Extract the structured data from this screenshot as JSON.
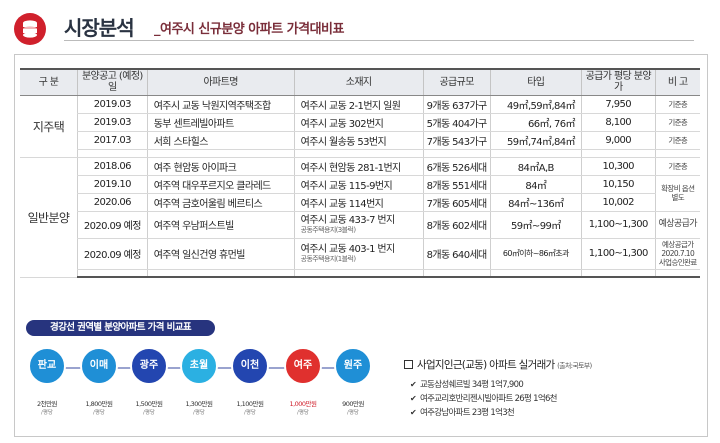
{
  "header": {
    "title": "시장분석",
    "subtitle": "_여주시 신규분양 아파트 가격대비표"
  },
  "table": {
    "headers": [
      "구 분",
      "분양공고 (예정)일",
      "아파트명",
      "소재지",
      "공급규모",
      "타입",
      "공급가 평당 분양가",
      "비 고"
    ],
    "groups": [
      {
        "label": "지주택",
        "rows": [
          {
            "date": "2019.03",
            "name": "여주시 교동 낙원지역주택조합",
            "addr": "여주시 교동 2-1번지 일원",
            "addr_sub": "",
            "scale": "9개동 637가구",
            "type": "49㎡,59㎡,84㎡",
            "price": "7,950",
            "note": "기준층"
          },
          {
            "date": "2019.03",
            "name": "동부 센트레빌아파트",
            "addr": "여주시 교동 302번지",
            "addr_sub": "",
            "scale": "5개동 404가구",
            "type": "66㎡, 76㎡",
            "price": "8,100",
            "note": "기준층"
          },
          {
            "date": "2017.03",
            "name": "서희 스타힐스",
            "addr": "여주시 월송동 53번지",
            "addr_sub": "",
            "scale": "7개동 543가구",
            "type": "59㎡,74㎡,84㎡",
            "price": "9,000",
            "note": "기준층"
          }
        ]
      },
      {
        "label": "일반분양",
        "rows": [
          {
            "date": "2018.06",
            "name": "여주 현암동 아이파크",
            "addr": "여주시 현암동 281-1번지",
            "addr_sub": "",
            "scale": "6개동 526세대",
            "type": "84㎡A,B",
            "price": "10,300",
            "note": "기준층"
          },
          {
            "date": "2019.10",
            "name": "여주역 대우푸르지오 클라레드",
            "addr": "여주시 교동 115-9번지",
            "addr_sub": "",
            "scale": "8개동 551세대",
            "type": "84㎡",
            "price": "10,150",
            "note": "확장비 옵션별도"
          },
          {
            "date": "2020.06",
            "name": "여주역 금호어울림 베르티스",
            "addr": "여주시 교동 114번지",
            "addr_sub": "",
            "scale": "7개동 605세대",
            "type": "84㎡~136㎡",
            "price": "10,002",
            "note": ""
          },
          {
            "date": "2020.09 예정",
            "name": "여주역 우남퍼스트빌",
            "addr": "여주시 교동 433-7 번지",
            "addr_sub": "공동주택용지(3블럭)",
            "scale": "8개동 602세대",
            "type": "59㎡~99㎡",
            "price": "1,100~1,300",
            "note": "예상공급가"
          },
          {
            "date": "2020.09 예정",
            "name": "여주역 일신건영 휴먼빌",
            "addr": "여주시 교동 403-1 번지",
            "addr_sub": "공동주택용지(1블럭)",
            "scale": "8개동 640세대",
            "type": "60㎡이하~86㎡초과",
            "price": "1,100~1,300",
            "note": "예상공급가 2020.7.10 사업승인완료"
          }
        ]
      }
    ]
  },
  "compare": {
    "title": "경강선 권역별 분양아파트 가격 비교표",
    "stations": [
      {
        "name": "판교",
        "price": "2천만원",
        "unit": "/평당",
        "color": "#1f8fd6"
      },
      {
        "name": "이매",
        "price": "1,800만원",
        "unit": "/평당",
        "color": "#1f8fd6"
      },
      {
        "name": "광주",
        "price": "1,500만원",
        "unit": "/평당",
        "color": "#2346b0"
      },
      {
        "name": "초월",
        "price": "1,300만원",
        "unit": "/평당",
        "color": "#2bb0e2"
      },
      {
        "name": "이천",
        "price": "1,100만원",
        "unit": "/평당",
        "color": "#2346b0"
      },
      {
        "name": "여주",
        "price": "1,000만원",
        "unit": "/평당",
        "color": "#e0302e"
      },
      {
        "name": "원주",
        "price": "900만원",
        "unit": "/평당",
        "color": "#1f8fd6"
      }
    ]
  },
  "trades": {
    "title": "사업지인근(교동) 아파트 실거래가",
    "source": "(출처:국토부)",
    "items": [
      "교동삼성쉐르빌 34평 1억7,900",
      "여주교리호반리젠시빌아파트 26평 1억6천",
      "여주강남아파트 23평 1억3천"
    ]
  }
}
